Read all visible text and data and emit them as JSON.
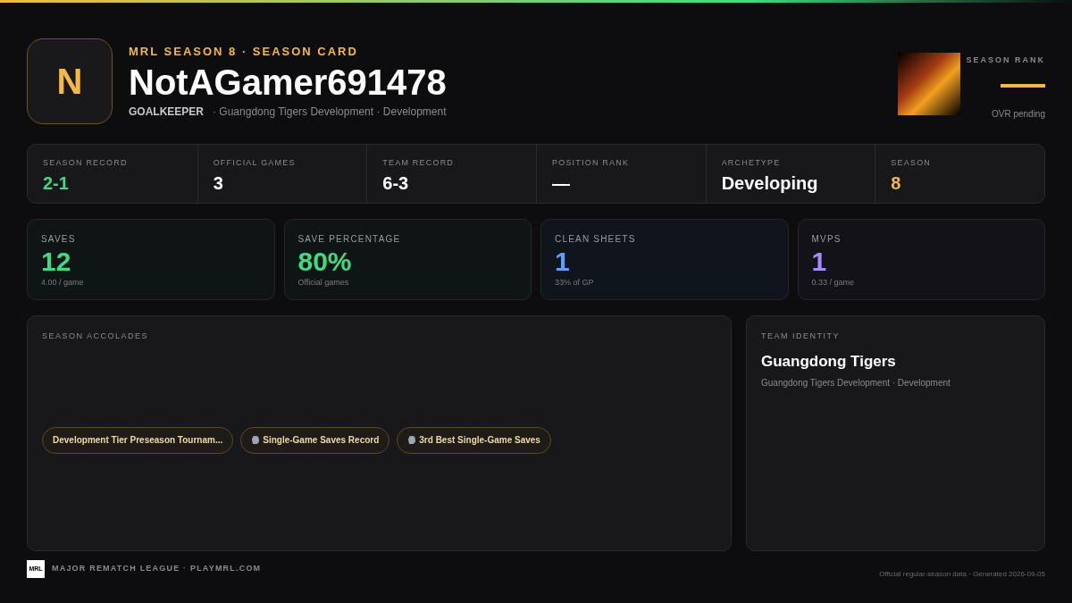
{
  "header": {
    "initial": "N",
    "eyebrow": "MRL SEASON 8 · SEASON CARD",
    "player_name": "NotAGamer691478",
    "position": "GOALKEEPER",
    "team_line": "· Guangdong Tigers Development · Development",
    "season_rank_label": "SEASON RANK",
    "rank_note": "OVR pending"
  },
  "record_strip": [
    {
      "label": "SEASON RECORD",
      "value": "2-1",
      "color": "#3ddc84"
    },
    {
      "label": "OFFICIAL GAMES",
      "value": "3",
      "color": "#ffffff"
    },
    {
      "label": "TEAM RECORD",
      "value": "6-3",
      "color": "#ffffff"
    },
    {
      "label": "POSITION RANK",
      "value": "—",
      "color": "#ffffff"
    },
    {
      "label": "ARCHETYPE",
      "value": "Developing",
      "color": "#ffffff"
    },
    {
      "label": "SEASON",
      "value": "8",
      "color": "#f5b942"
    }
  ],
  "stat_cards": [
    {
      "label": "SAVES",
      "value": "12",
      "sub": "4.00 / game",
      "color": "#3ddc84"
    },
    {
      "label": "SAVE PERCENTAGE",
      "value": "80%",
      "sub": "Official games",
      "color": "#3ddc84"
    },
    {
      "label": "CLEAN SHEETS",
      "value": "1",
      "sub": "33% of GP",
      "color": "#5aa2f5"
    },
    {
      "label": "MVPS",
      "value": "1",
      "sub": "0.33 / game",
      "color": "#a78bfa"
    }
  ],
  "accolades": {
    "title": "SEASON ACCOLADES",
    "items": [
      {
        "label": "Development Tier Preseason Tournam...",
        "kind": "plain"
      },
      {
        "label": "Single-Game Saves Record",
        "kind": "glove"
      },
      {
        "label": "3rd Best Single-Game Saves",
        "kind": "glove"
      }
    ]
  },
  "team_identity": {
    "title": "TEAM IDENTITY",
    "name": "Guangdong Tigers",
    "sub": "Guangdong Tigers Development · Development"
  },
  "footer": {
    "logo": "MRL",
    "league": "MAJOR REMATCH LEAGUE · PLAYMRL.COM",
    "note": "Official regular-season data · Generated 2026-09-05"
  }
}
